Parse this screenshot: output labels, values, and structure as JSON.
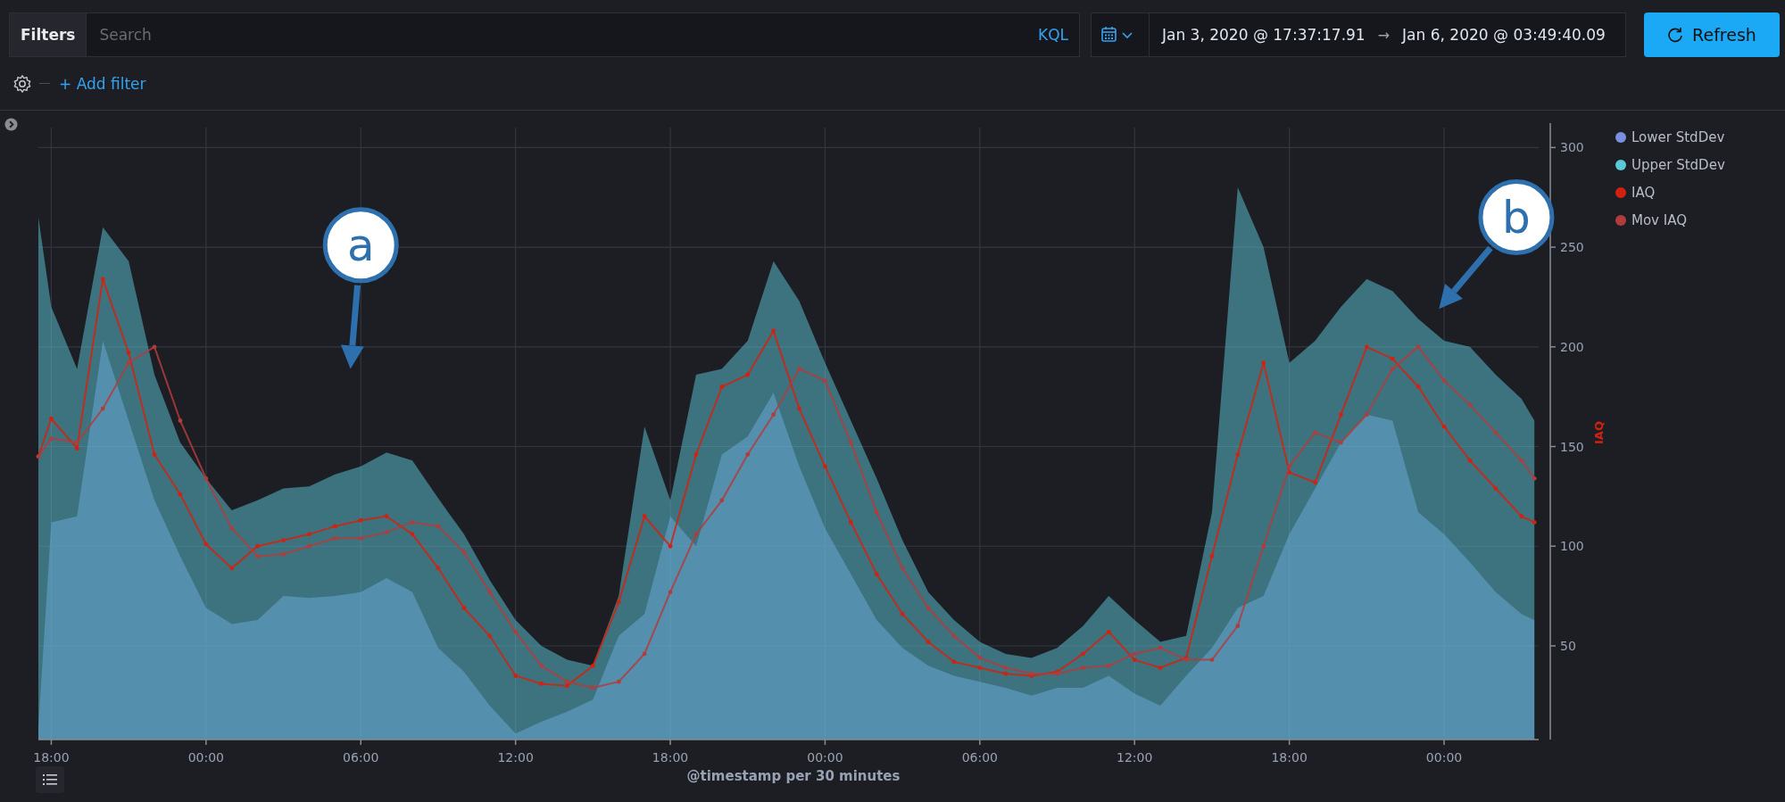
{
  "query_bar": {
    "filters_label": "Filters",
    "search": {
      "placeholder": "Search"
    },
    "language": "KQL",
    "date_range": {
      "start": "Jan 3, 2020 @ 17:37:17.91",
      "arrow": "→",
      "end": "Jan 6, 2020 @ 03:49:40.09"
    },
    "refresh_button": "Refresh"
  },
  "filter_row": {
    "add_filter": "+ Add filter"
  },
  "visualization": {
    "chart_data": {
      "type": "area",
      "xlabel": "@timestamp per 30 minutes",
      "ylabel": "IAQ",
      "xlim": [
        "2020-01-03T17:30",
        "2020-01-06T03:40"
      ],
      "ylim": [
        3,
        310
      ],
      "x": [
        "2020-01-03T17:30",
        "2020-01-03T18:00",
        "2020-01-03T19:00",
        "2020-01-03T20:00",
        "2020-01-03T21:00",
        "2020-01-03T22:00",
        "2020-01-03T23:00",
        "2020-01-04T00:00",
        "2020-01-04T01:00",
        "2020-01-04T02:00",
        "2020-01-04T03:00",
        "2020-01-04T04:00",
        "2020-01-04T05:00",
        "2020-01-04T06:00",
        "2020-01-04T07:00",
        "2020-01-04T08:00",
        "2020-01-04T09:00",
        "2020-01-04T10:00",
        "2020-01-04T11:00",
        "2020-01-04T12:00",
        "2020-01-04T13:00",
        "2020-01-04T14:00",
        "2020-01-04T15:00",
        "2020-01-04T16:00",
        "2020-01-04T17:00",
        "2020-01-04T18:00",
        "2020-01-04T19:00",
        "2020-01-04T20:00",
        "2020-01-04T21:00",
        "2020-01-04T22:00",
        "2020-01-04T23:00",
        "2020-01-05T00:00",
        "2020-01-05T01:00",
        "2020-01-05T02:00",
        "2020-01-05T03:00",
        "2020-01-05T04:00",
        "2020-01-05T05:00",
        "2020-01-05T06:00",
        "2020-01-05T07:00",
        "2020-01-05T08:00",
        "2020-01-05T09:00",
        "2020-01-05T10:00",
        "2020-01-05T11:00",
        "2020-01-05T12:00",
        "2020-01-05T13:00",
        "2020-01-05T14:00",
        "2020-01-05T15:00",
        "2020-01-05T16:00",
        "2020-01-05T17:00",
        "2020-01-05T18:00",
        "2020-01-05T19:00",
        "2020-01-05T20:00",
        "2020-01-05T21:00",
        "2020-01-05T22:00",
        "2020-01-05T23:00",
        "2020-01-06T00:00",
        "2020-01-06T01:00",
        "2020-01-06T02:00",
        "2020-01-06T03:00",
        "2020-01-06T03:30"
      ],
      "xticks": [
        {
          "value": "2020-01-03T18:00",
          "label": "18:00"
        },
        {
          "value": "2020-01-04T00:00",
          "label": "00:00"
        },
        {
          "value": "2020-01-04T06:00",
          "label": "06:00"
        },
        {
          "value": "2020-01-04T12:00",
          "label": "12:00"
        },
        {
          "value": "2020-01-04T18:00",
          "label": "18:00"
        },
        {
          "value": "2020-01-05T00:00",
          "label": "00:00"
        },
        {
          "value": "2020-01-05T06:00",
          "label": "06:00"
        },
        {
          "value": "2020-01-05T12:00",
          "label": "12:00"
        },
        {
          "value": "2020-01-05T18:00",
          "label": "18:00"
        },
        {
          "value": "2020-01-06T00:00",
          "label": "00:00"
        }
      ],
      "yticks": [
        50,
        100,
        150,
        200,
        250,
        300
      ],
      "grid": true,
      "series": [
        {
          "name": "Lower StdDev",
          "type": "area",
          "color": "#7b8fe0",
          "values": [
            9,
            112,
            115,
            203,
            163,
            123,
            95,
            69,
            61,
            63,
            75,
            74,
            75,
            77,
            84,
            77,
            49,
            37,
            20,
            6,
            12,
            17,
            23,
            55,
            66,
            115,
            100,
            146,
            155,
            177,
            140,
            109,
            86,
            63,
            49,
            40,
            35,
            32,
            29,
            25,
            29,
            29,
            35,
            26,
            20,
            35,
            49,
            69,
            75,
            106,
            129,
            152,
            166,
            163,
            117,
            106,
            92,
            77,
            66,
            63
          ]
        },
        {
          "name": "Upper StdDev",
          "type": "area",
          "color": "#5bc8d9",
          "values": [
            265,
            220,
            189,
            260,
            243,
            186,
            152,
            134,
            118,
            123,
            129,
            130,
            136,
            140,
            147,
            143,
            124,
            106,
            83,
            63,
            50,
            43,
            40,
            75,
            160,
            123,
            186,
            189,
            203,
            243,
            223,
            192,
            163,
            134,
            103,
            77,
            63,
            52,
            46,
            44,
            49,
            60,
            75,
            63,
            52,
            55,
            117,
            280,
            250,
            192,
            203,
            220,
            234,
            228,
            214,
            203,
            200,
            186,
            174,
            163
          ]
        },
        {
          "name": "IAQ",
          "type": "line",
          "color": "#d2220f",
          "values": [
            145,
            164,
            149,
            234,
            197,
            146,
            126,
            101,
            89,
            100,
            103,
            106,
            110,
            113,
            115,
            106,
            89,
            69,
            55,
            35,
            31,
            30,
            40,
            72,
            115,
            100,
            146,
            180,
            186,
            208,
            169,
            140,
            112,
            86,
            66,
            52,
            42,
            39,
            36,
            35,
            37,
            46,
            57,
            43,
            39,
            44,
            95,
            146,
            192,
            137,
            132,
            166,
            200,
            194,
            180,
            160,
            143,
            129,
            115,
            112
          ]
        },
        {
          "name": "Mov IAQ",
          "type": "line",
          "color": "#b23c3c",
          "values": [
            145,
            154,
            152,
            169,
            192,
            200,
            163,
            134,
            109,
            95,
            96,
            100,
            104,
            104,
            107,
            112,
            110,
            97,
            77,
            57,
            40,
            32,
            29,
            32,
            46,
            77,
            106,
            123,
            146,
            166,
            189,
            183,
            152,
            117,
            89,
            69,
            55,
            44,
            39,
            36,
            36,
            39,
            40,
            46,
            49,
            43,
            43,
            60,
            100,
            140,
            157,
            152,
            166,
            189,
            200,
            183,
            171,
            157,
            143,
            134
          ]
        }
      ],
      "annotations": [
        "a",
        "b"
      ]
    }
  }
}
